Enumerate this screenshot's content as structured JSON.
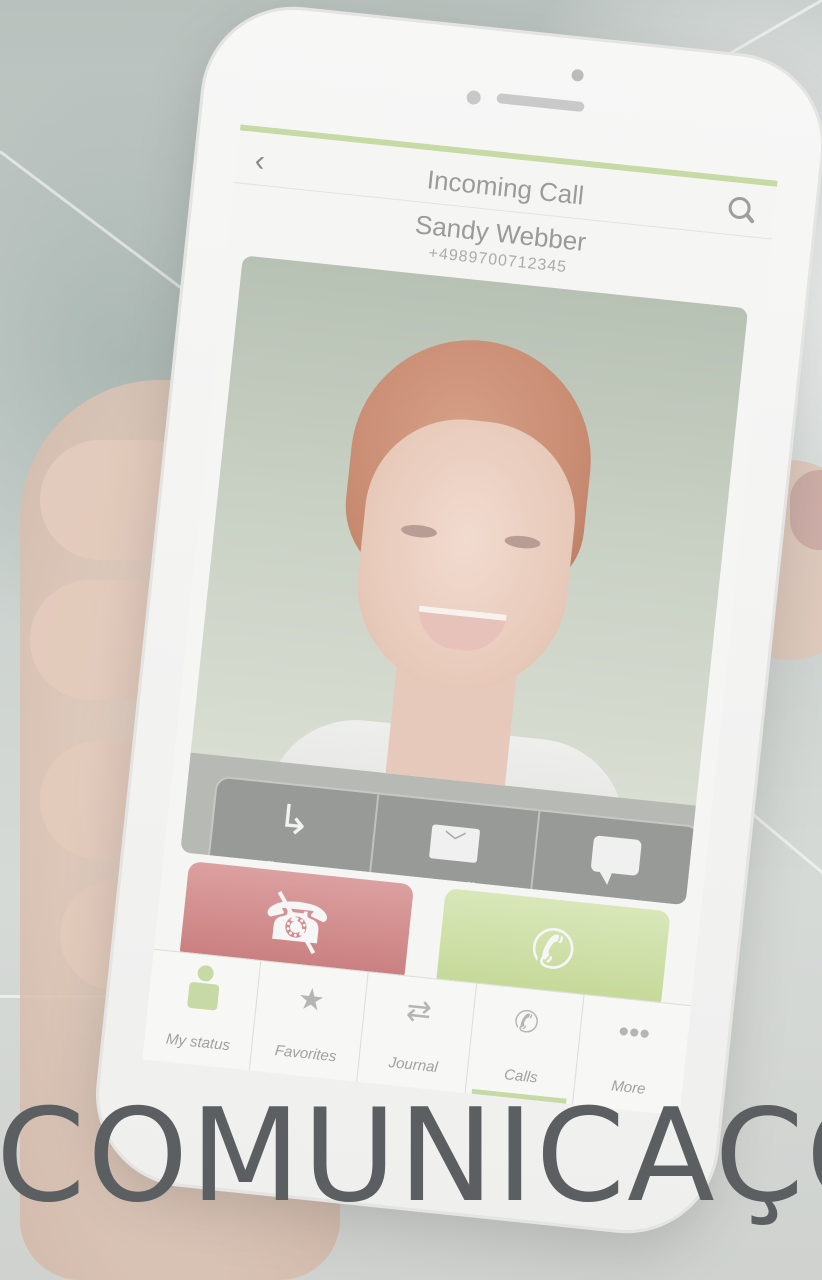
{
  "screen": {
    "title": "Incoming Call",
    "caller": {
      "name": "Sandy Webber",
      "number": "+4989700712345"
    },
    "actions": [
      {
        "label": "Deflect to...",
        "icon": "deflect-icon"
      },
      {
        "label": "Email",
        "icon": "email-icon"
      },
      {
        "label": "SMS",
        "icon": "sms-icon"
      }
    ],
    "call_buttons": {
      "decline_icon": "hang-up-icon",
      "accept_icon": "phone-icon",
      "decline_color": "#c97d7d",
      "accept_color": "#c4d897"
    },
    "tabs": [
      {
        "label": "My status",
        "icon": "person-icon"
      },
      {
        "label": "Favorites",
        "icon": "star-icon"
      },
      {
        "label": "Journal",
        "icon": "arrows-icon"
      },
      {
        "label": "Calls",
        "icon": "handset-icon",
        "active": true
      },
      {
        "label": "More",
        "icon": "more-icon"
      }
    ],
    "accent_color": "#c7d9a4"
  },
  "overlay": {
    "headline": "COMUNICAÇÕ"
  }
}
